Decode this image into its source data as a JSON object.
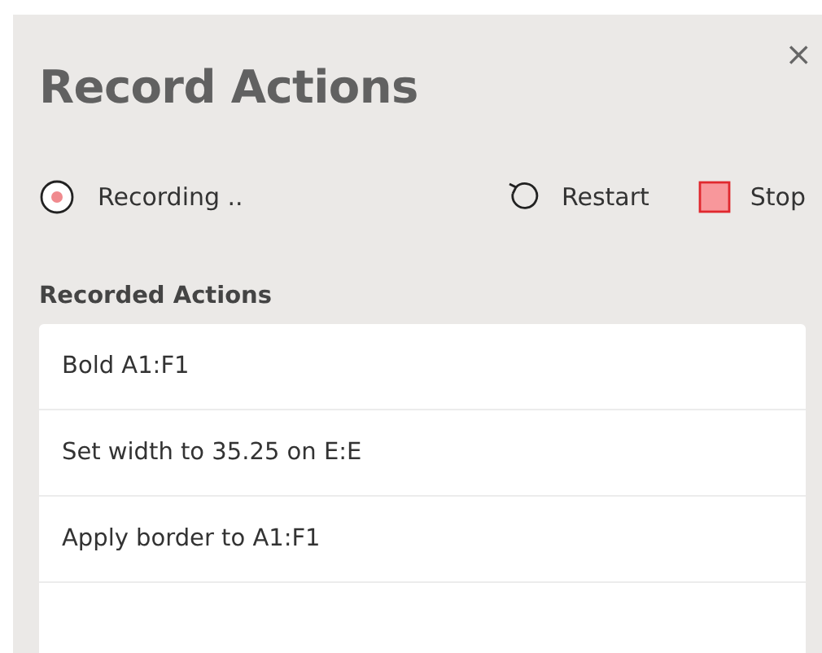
{
  "panel": {
    "title": "Record Actions",
    "close": "×"
  },
  "status": {
    "label": "Recording ..",
    "recording": true
  },
  "buttons": [
    {
      "kind": "restart",
      "label": "Restart"
    },
    {
      "kind": "stop",
      "label": "Stop"
    }
  ],
  "list": {
    "heading": "Recorded Actions",
    "items": [
      "Bold A1:F1",
      "Set width to 35.25 on E:E",
      "Apply border to A1:F1"
    ]
  }
}
